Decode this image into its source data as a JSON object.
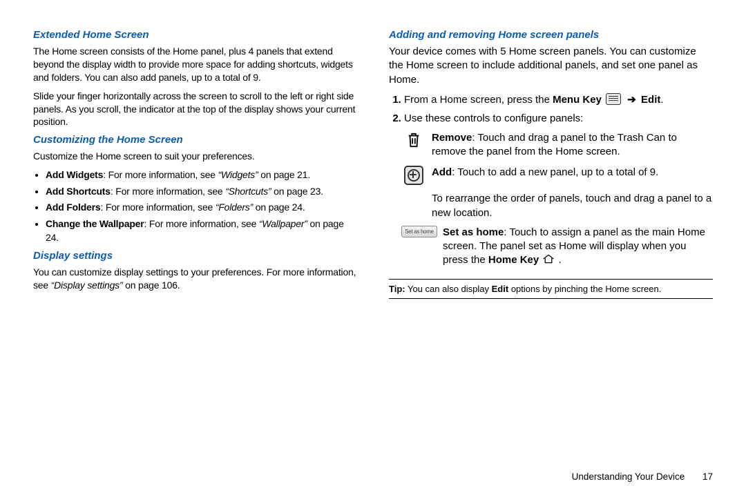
{
  "left": {
    "h1": "Extended Home Screen",
    "p1": "The Home screen consists of the Home panel, plus 4 panels that extend beyond the display width to provide more space for adding shortcuts, widgets and folders. You can also add panels, up to a total of 9.",
    "p2": "Slide your finger horizontally across the screen to scroll to the left or right side panels. As you scroll, the indicator at the top of the display shows your current position.",
    "h2": "Customizing the Home Screen",
    "p3": "Customize the Home screen to suit your preferences.",
    "b1_strong": "Add Widgets",
    "b1_rest": ": For more information, see ",
    "b1_ref": "“Widgets”",
    "b1_pg": " on page 21.",
    "b2_strong": "Add Shortcuts",
    "b2_rest": ": For more information, see ",
    "b2_ref": "“Shortcuts”",
    "b2_pg": " on page 23.",
    "b3_strong": "Add Folders",
    "b3_rest": ": For more information, see ",
    "b3_ref": "“Folders”",
    "b3_pg": " on page 24.",
    "b4_strong": "Change the Wallpaper",
    "b4_rest": ": For more information, see ",
    "b4_ref": "“Wallpaper”",
    "b4_pg": " on page 24.",
    "h3": "Display settings",
    "p4a": "You can customize display settings to your preferences. For more information, see ",
    "p4ref": "“Display settings”",
    "p4b": " on page 106."
  },
  "right": {
    "h1": "Adding and removing Home screen panels",
    "p1": "Your device comes with 5 Home screen panels. You can customize the Home screen to include additional panels, and set one panel as Home.",
    "step1a": "From a Home screen, press the ",
    "step1_menu": "Menu Key",
    "step1_edit": "Edit",
    "step1_end": ".",
    "step2": "Use these controls to configure panels:",
    "remove_strong": "Remove",
    "remove_txt": ": Touch and drag a panel to the Trash Can to remove the panel from the Home screen.",
    "add_strong": "Add",
    "add_txt": ": Touch to add a new panel, up to a total of 9.",
    "rearr": "To rearrange the order of panels, touch and drag a panel to a new location.",
    "sethome_label": "Set as home",
    "sethome_strong": "Set as home",
    "sethome_txt1": ": Touch to assign a panel as the main Home screen. The panel set as Home will display when you press the ",
    "homekey": "Home Key",
    "sethome_end": " .",
    "tip_label": "Tip:",
    "tip_a": " You can also display ",
    "tip_b": "Edit",
    "tip_c": " options by pinching the Home screen."
  },
  "footer": {
    "section": "Understanding Your Device",
    "page": "17"
  }
}
